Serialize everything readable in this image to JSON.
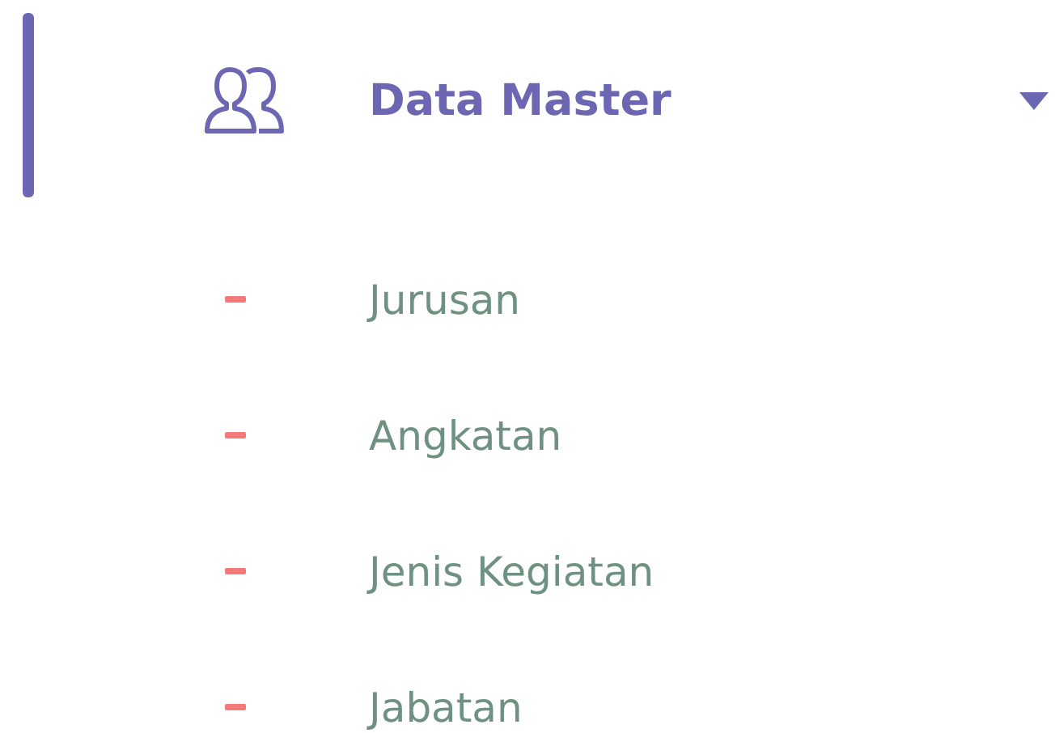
{
  "menu": {
    "label": "Data Master",
    "active": true,
    "expanded": true,
    "children": [
      {
        "label": "Jurusan"
      },
      {
        "label": "Angkatan"
      },
      {
        "label": "Jenis Kegiatan"
      },
      {
        "label": "Jabatan"
      }
    ]
  }
}
